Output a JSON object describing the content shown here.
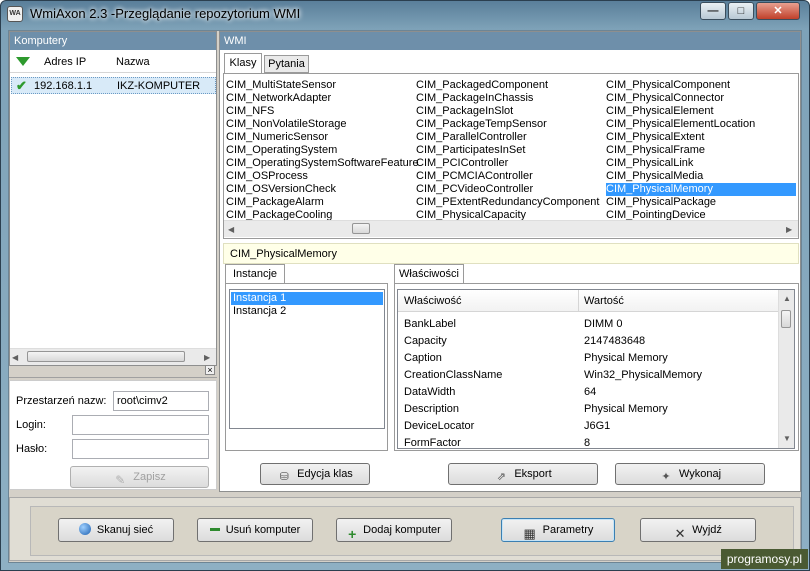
{
  "window": {
    "title": "WmiAxon 2.3 -Przeglądanie repozytorium WMI",
    "icon_text": "WA"
  },
  "computers": {
    "header": "Komputery",
    "col_ip": "Adres IP",
    "col_name": "Nazwa",
    "rows": [
      {
        "ip": "192.168.1.1",
        "name": "IKZ-KOMPUTER"
      }
    ]
  },
  "login": {
    "namespace_label": "Przestarzeń nazw:",
    "namespace_value": "root\\cimv2",
    "login_label": "Login:",
    "login_value": "",
    "password_label": "Hasło:",
    "password_value": "",
    "save_label": "Zapisz"
  },
  "wmi": {
    "header": "WMI",
    "tabs": [
      "Klasy",
      "Pytania"
    ],
    "classes_col1": [
      "CIM_MultiStateSensor",
      "CIM_NetworkAdapter",
      "CIM_NFS",
      "CIM_NonVolatileStorage",
      "CIM_NumericSensor",
      "CIM_OperatingSystem",
      "CIM_OperatingSystemSoftwareFeature",
      "CIM_OSProcess",
      "CIM_OSVersionCheck",
      "CIM_PackageAlarm",
      "CIM_PackageCooling"
    ],
    "classes_col2": [
      "CIM_PackagedComponent",
      "CIM_PackageInChassis",
      "CIM_PackageInSlot",
      "CIM_PackageTempSensor",
      "CIM_ParallelController",
      "CIM_ParticipatesInSet",
      "CIM_PCIController",
      "CIM_PCMCIAController",
      "CIM_PCVideoController",
      "CIM_PExtentRedundancyComponent",
      "CIM_PhysicalCapacity"
    ],
    "classes_col3": [
      "CIM_PhysicalComponent",
      "CIM_PhysicalConnector",
      "CIM_PhysicalElement",
      "CIM_PhysicalElementLocation",
      "CIM_PhysicalExtent",
      "CIM_PhysicalFrame",
      "CIM_PhysicalLink",
      "CIM_PhysicalMedia",
      "CIM_PhysicalMemory",
      "CIM_PhysicalPackage",
      "CIM_PointingDevice"
    ],
    "selected_class": "CIM_PhysicalMemory"
  },
  "instances": {
    "tab": "Instancje",
    "items": [
      "Instancja 1",
      "Instancja 2"
    ],
    "selected": "Instancja 1"
  },
  "properties": {
    "tab": "Właściwości",
    "col_prop": "Właściwość",
    "col_val": "Wartość",
    "rows": [
      {
        "name": "BankLabel",
        "value": "DIMM 0"
      },
      {
        "name": "Capacity",
        "value": "2147483648"
      },
      {
        "name": "Caption",
        "value": "Physical Memory"
      },
      {
        "name": "CreationClassName",
        "value": "Win32_PhysicalMemory"
      },
      {
        "name": "DataWidth",
        "value": "64"
      },
      {
        "name": "Description",
        "value": "Physical Memory"
      },
      {
        "name": "DeviceLocator",
        "value": "J6G1"
      },
      {
        "name": "FormFactor",
        "value": "8"
      }
    ]
  },
  "actions": {
    "edit_classes": "Edycja klas",
    "export": "Eksport",
    "execute": "Wykonaj"
  },
  "bottom": {
    "scan": "Skanuj sieć",
    "remove": "Usuń komputer",
    "add": "Dodaj komputer",
    "params": "Parametry",
    "exit": "Wyjdź"
  },
  "watermark": "programosy.pl"
}
